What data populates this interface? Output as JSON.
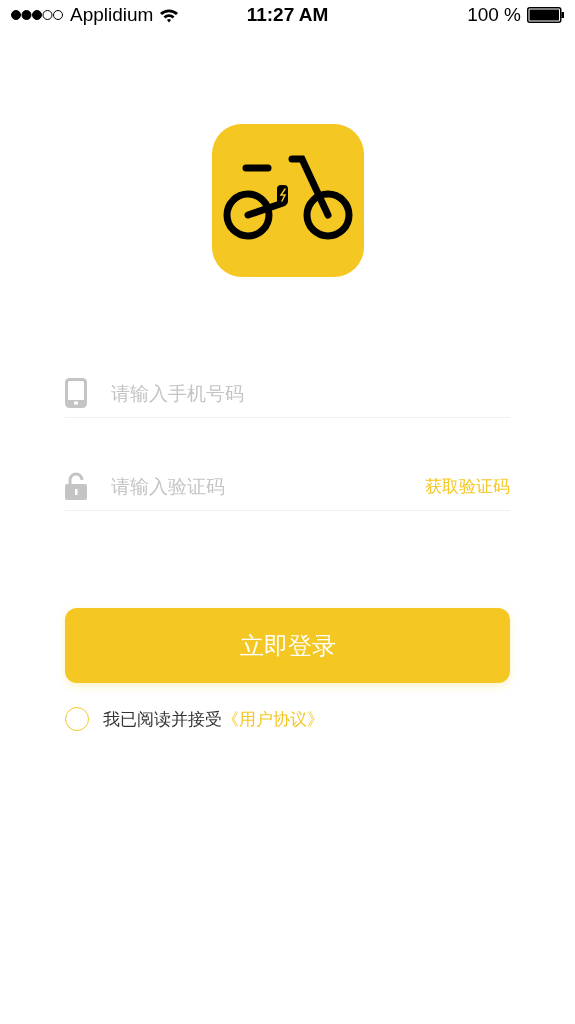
{
  "status_bar": {
    "carrier": "Applidium",
    "time": "11:27 AM",
    "battery": "100 %"
  },
  "phone_field": {
    "placeholder": "请输入手机号码"
  },
  "code_field": {
    "placeholder": "请输入验证码",
    "action": "获取验证码"
  },
  "login_button": "立即登录",
  "agreement": {
    "checked": false,
    "text": "我已阅读并接受",
    "link": "《用户协议》"
  }
}
